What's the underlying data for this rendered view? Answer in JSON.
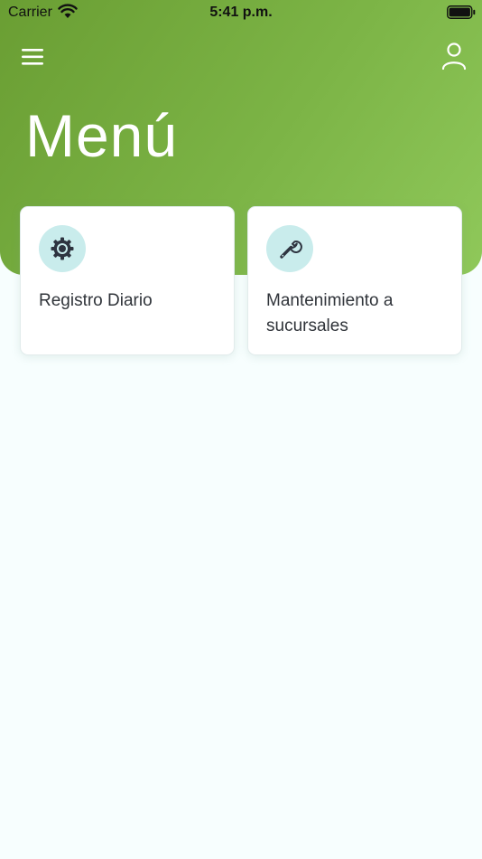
{
  "status_bar": {
    "carrier": "Carrier",
    "time": "5:41 p.m.",
    "wifi_icon": "wifi-icon",
    "battery_icon": "battery-icon"
  },
  "header": {
    "title": "Menú",
    "menu_icon": "hamburger-menu-icon",
    "profile_icon": "user-profile-icon"
  },
  "cards": [
    {
      "label": "Registro Diario",
      "icon": "gear-icon"
    },
    {
      "label": "Mantenimiento a sucursales",
      "icon": "wrench-icon"
    }
  ],
  "colors": {
    "header_gradient_start": "#6a9e33",
    "header_gradient_end": "#8fc85a",
    "icon_circle": "#c9ecec",
    "background": "#f7fefe"
  }
}
